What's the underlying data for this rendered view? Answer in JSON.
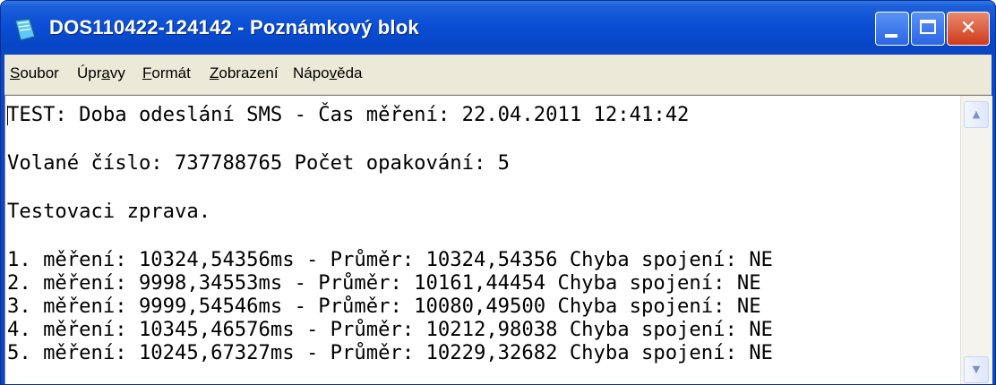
{
  "window": {
    "title": "DOS110422-124142 - Poznámkový blok",
    "buttons": {
      "minimize": "minimize",
      "maximize": "maximize",
      "close": "✕"
    }
  },
  "menu": [
    {
      "label": "Soubor",
      "accel_index": 0
    },
    {
      "label": "Úpravy",
      "accel_index": 3
    },
    {
      "label": "Formát",
      "accel_index": 0
    },
    {
      "label": "Zobrazení",
      "accel_index": 0
    },
    {
      "label": "Nápověda",
      "accel_index": 4
    }
  ],
  "document": {
    "header": "TEST: Doba odeslání SMS - Čas měření: 22.04.2011 12:41:42",
    "called_number": "Volané číslo: 737788765 Počet opakování: 5",
    "message": "Testovaci zprava.",
    "measurements": [
      "1. měření: 10324,54356ms - Průměr: 10324,54356 Chyba spojení: NE",
      "2. měření: 9998,34553ms - Průměr: 10161,44454 Chyba spojení: NE",
      "3. měření: 9999,54546ms - Průměr: 10080,49500 Chyba spojení: NE",
      "4. měření: 10345,46576ms - Průměr: 10212,98038 Chyba spojení: NE",
      "5. měření: 10245,67327ms - Průměr: 10229,32682 Chyba spojení: NE"
    ]
  },
  "scrollbar": {
    "up_icon": "▲",
    "down_icon": "▼"
  }
}
